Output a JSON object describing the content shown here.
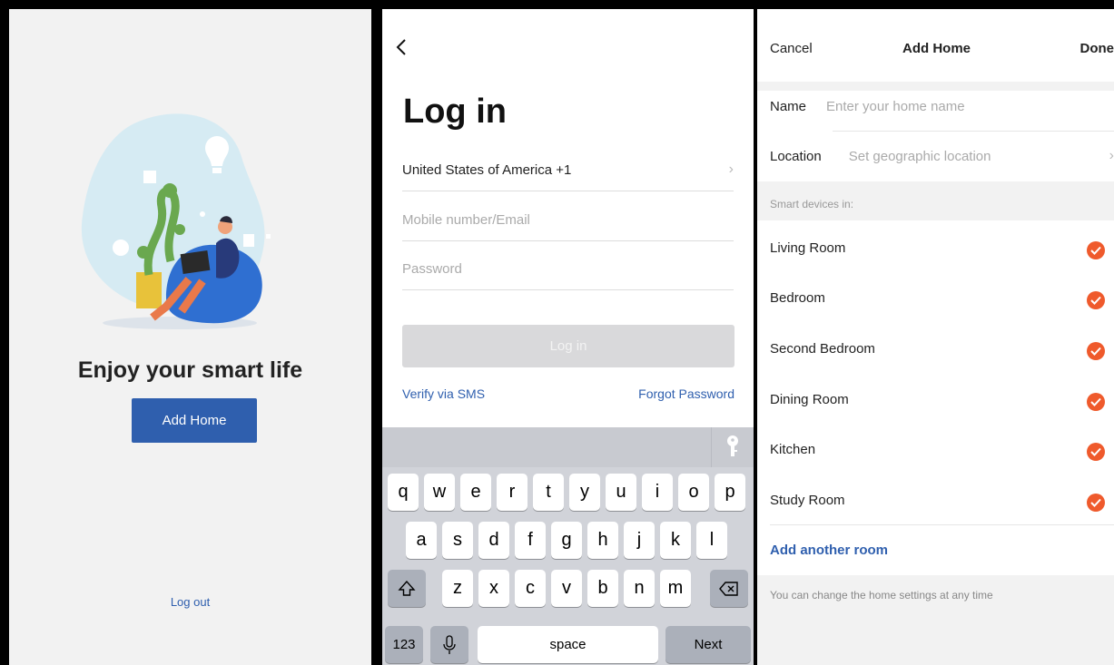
{
  "home": {
    "title": "Enjoy your smart life",
    "add_home_label": "Add Home",
    "logout_label": "Log out"
  },
  "login": {
    "title": "Log in",
    "country": "United States of America +1",
    "username_placeholder": "Mobile number/Email",
    "password_placeholder": "Password",
    "login_label": "Log in",
    "verify_sms": "Verify via SMS",
    "forgot_password": "Forgot Password",
    "keyboard": {
      "row1": [
        "q",
        "w",
        "e",
        "r",
        "t",
        "y",
        "u",
        "i",
        "o",
        "p"
      ],
      "row2": [
        "a",
        "s",
        "d",
        "f",
        "g",
        "h",
        "j",
        "k",
        "l"
      ],
      "row3": [
        "z",
        "x",
        "c",
        "v",
        "b",
        "n",
        "m"
      ],
      "numbers_label": "123",
      "space_label": "space",
      "next_label": "Next"
    }
  },
  "add_home": {
    "cancel": "Cancel",
    "title": "Add Home",
    "done": "Done",
    "name_label": "Name",
    "name_placeholder": "Enter your home name",
    "location_label": "Location",
    "location_placeholder": "Set geographic location",
    "section_label": "Smart devices in:",
    "rooms": [
      {
        "name": "Living Room",
        "checked": true
      },
      {
        "name": "Bedroom",
        "checked": true
      },
      {
        "name": "Second Bedroom",
        "checked": true
      },
      {
        "name": "Dining Room",
        "checked": true
      },
      {
        "name": "Kitchen",
        "checked": true
      },
      {
        "name": "Study Room",
        "checked": true
      }
    ],
    "add_room": "Add another room",
    "footer_note": "You can change the home settings at any time"
  },
  "colors": {
    "brand_blue": "#2f5fae",
    "check_orange": "#ef5a2c",
    "disabled_button": "#d9d9db"
  }
}
